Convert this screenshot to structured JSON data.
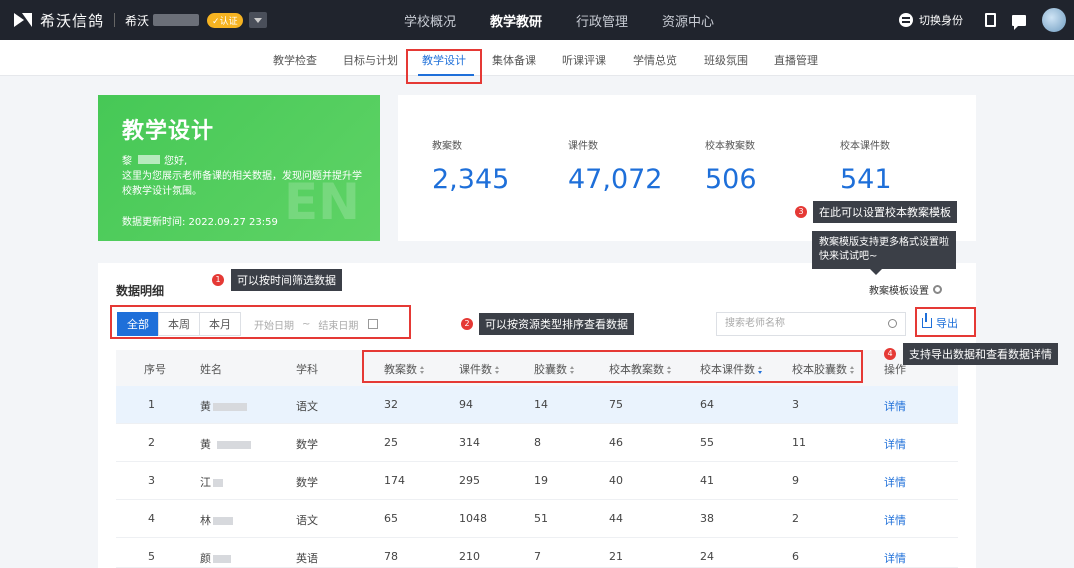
{
  "topbar": {
    "brand": "希沃信鸽",
    "school_prefix": "希沃",
    "cert_badge": "✓认证",
    "nav": [
      {
        "label": "学校概况",
        "active": false
      },
      {
        "label": "教学教研",
        "active": true
      },
      {
        "label": "行政管理",
        "active": false
      },
      {
        "label": "资源中心",
        "active": false
      }
    ],
    "switch_identity": "切换身份"
  },
  "subnav": {
    "items": [
      {
        "label": "教学检查",
        "active": false
      },
      {
        "label": "目标与计划",
        "active": false
      },
      {
        "label": "教学设计",
        "active": true
      },
      {
        "label": "集体备课",
        "active": false
      },
      {
        "label": "听课评课",
        "active": false
      },
      {
        "label": "学情总览",
        "active": false
      },
      {
        "label": "班级氛围",
        "active": false
      },
      {
        "label": "直播管理",
        "active": false
      }
    ]
  },
  "hero": {
    "title": "教学设计",
    "name_prefix": "黎",
    "greeting": "您好,",
    "description": "这里为您展示老师备课的相关数据，发现问题并提升学校教学设计氛围。",
    "update_time": "数据更新时间: 2022.09.27 23:59",
    "watermark": "EN"
  },
  "stats": [
    {
      "label": "教案数",
      "value": "2,345"
    },
    {
      "label": "课件数",
      "value": "47,072"
    },
    {
      "label": "校本教案数",
      "value": "506"
    },
    {
      "label": "校本课件数",
      "value": "541"
    }
  ],
  "annotations": {
    "a1": {
      "num": "1",
      "text": "可以按时间筛选数据"
    },
    "a2": {
      "num": "2",
      "text": "可以按资源类型排序查看数据"
    },
    "a3": {
      "num": "3",
      "text": "在此可以设置校本教案模板"
    },
    "a4": {
      "num": "4",
      "text": "支持导出数据和查看数据详情"
    },
    "template_tip": "教案模版支持更多格式设置啦快来试试吧~"
  },
  "details": {
    "title": "数据明细",
    "template_settings": "教案模板设置",
    "time_filters": [
      {
        "label": "全部",
        "active": true
      },
      {
        "label": "本周",
        "active": false
      },
      {
        "label": "本月",
        "active": false
      }
    ],
    "start_date_placeholder": "开始日期",
    "range_sep": "~",
    "end_date_placeholder": "结束日期",
    "search_placeholder": "搜索老师名称",
    "export_label": "导出",
    "columns": [
      "序号",
      "姓名",
      "学科",
      "教案数",
      "课件数",
      "胶囊数",
      "校本教案数",
      "校本课件数",
      "校本胶囊数",
      "操作"
    ],
    "rows": [
      {
        "no": "1",
        "name": "黄",
        "subject": "语文",
        "lesson_plans": "32",
        "courseware": "94",
        "capsules": "14",
        "school_plans": "75",
        "school_courseware": "64",
        "school_capsules": "3",
        "action": "详情"
      },
      {
        "no": "2",
        "name": "黄 ",
        "subject": "数学",
        "lesson_plans": "25",
        "courseware": "314",
        "capsules": "8",
        "school_plans": "46",
        "school_courseware": "55",
        "school_capsules": "11",
        "action": "详情"
      },
      {
        "no": "3",
        "name": "江",
        "subject": "数学",
        "lesson_plans": "174",
        "courseware": "295",
        "capsules": "19",
        "school_plans": "40",
        "school_courseware": "41",
        "school_capsules": "9",
        "action": "详情"
      },
      {
        "no": "4",
        "name": "林",
        "subject": "语文",
        "lesson_plans": "65",
        "courseware": "1048",
        "capsules": "51",
        "school_plans": "44",
        "school_courseware": "38",
        "school_capsules": "2",
        "action": "详情"
      },
      {
        "no": "5",
        "name": "颜",
        "subject": "英语",
        "lesson_plans": "78",
        "courseware": "210",
        "capsules": "7",
        "school_plans": "21",
        "school_courseware": "24",
        "school_capsules": "6",
        "action": "详情"
      }
    ]
  },
  "colors": {
    "accent": "#1e6fd9",
    "hero_green": "#4ccb5b",
    "highlight_red": "#e53935",
    "topbar": "#20242d"
  }
}
